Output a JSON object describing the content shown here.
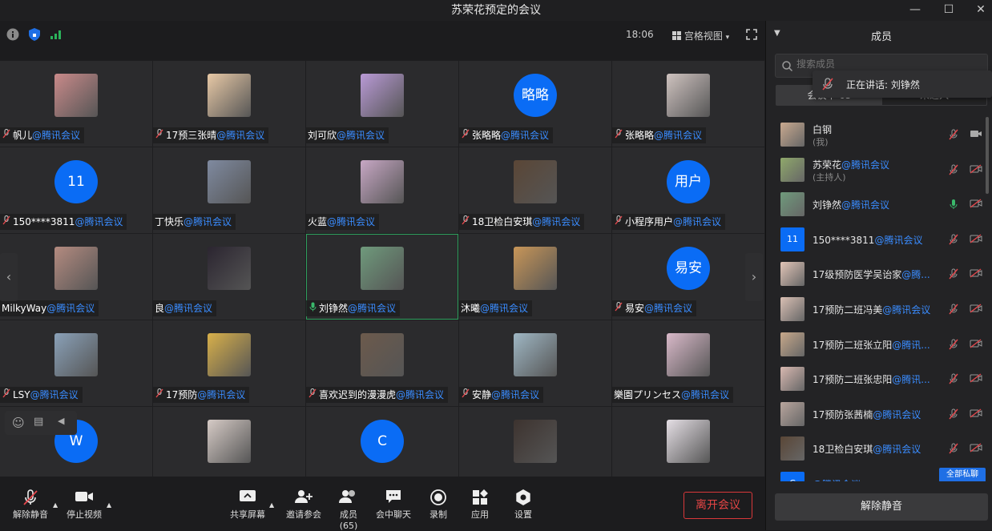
{
  "window": {
    "title": "苏荣花预定的会议",
    "minimize": "—",
    "maximize": "☐",
    "close": "✕"
  },
  "topbar": {
    "time": "18:06",
    "view_label": "宫格视图",
    "view_caret": "▾"
  },
  "grid": {
    "tiles": [
      {
        "name": "帆儿",
        "tag": "@腾讯会议",
        "mic": "muted",
        "avatar": {
          "type": "image",
          "color": "#c98a8a"
        }
      },
      {
        "name": "17预三张晴",
        "tag": "@腾讯会议",
        "mic": "muted",
        "avatar": {
          "type": "image",
          "color": "#e8c9a6"
        }
      },
      {
        "name": "刘可欣",
        "tag": "@腾讯会议",
        "mic": "none",
        "avatar": {
          "type": "image",
          "color": "#b99ad6"
        }
      },
      {
        "name": "张略略",
        "tag": "@腾讯会议",
        "mic": "muted",
        "avatar": {
          "type": "text",
          "text": "略略"
        }
      },
      {
        "name": "张略略",
        "tag": "@腾讯会议",
        "mic": "muted",
        "avatar": {
          "type": "image",
          "color": "#cfc3c0"
        }
      },
      {
        "name": "150****3811",
        "tag": "@腾讯会议",
        "mic": "muted",
        "avatar": {
          "type": "text",
          "text": "11"
        }
      },
      {
        "name": "丁快乐",
        "tag": "@腾讯会议",
        "mic": "none",
        "avatar": {
          "type": "image",
          "color": "#7f8aa0"
        }
      },
      {
        "name": "火蓝",
        "tag": "@腾讯会议",
        "mic": "none",
        "avatar": {
          "type": "image",
          "color": "#c7a7c4"
        }
      },
      {
        "name": "18卫检白安琪",
        "tag": "@腾讯会议",
        "mic": "muted",
        "avatar": {
          "type": "image",
          "color": "#5a4636"
        }
      },
      {
        "name": "小程序用户",
        "tag": "@腾讯会议",
        "mic": "muted",
        "avatar": {
          "type": "text",
          "text": "用户"
        }
      },
      {
        "name": "MilkyWay",
        "tag": "@腾讯会议",
        "mic": "none",
        "avatar": {
          "type": "image",
          "color": "#b48b80"
        }
      },
      {
        "name": "良",
        "tag": "@腾讯会议",
        "mic": "none",
        "avatar": {
          "type": "image",
          "color": "#2b2530"
        }
      },
      {
        "name": "刘铮然",
        "tag": "@腾讯会议",
        "mic": "on",
        "avatar": {
          "type": "image",
          "color": "#6f9a7c"
        },
        "active": true
      },
      {
        "name": "沐曦",
        "tag": "@腾讯会议",
        "mic": "none",
        "avatar": {
          "type": "image",
          "color": "#c89658"
        }
      },
      {
        "name": "易安",
        "tag": "@腾讯会议",
        "mic": "muted",
        "avatar": {
          "type": "text",
          "text": "易安"
        }
      },
      {
        "name": "LSY",
        "tag": "@腾讯会议",
        "mic": "muted",
        "avatar": {
          "type": "image",
          "color": "#8aa1b8"
        }
      },
      {
        "name": "17预防",
        "tag": "@腾讯会议",
        "mic": "muted",
        "avatar": {
          "type": "image",
          "color": "#d8b04a"
        }
      },
      {
        "name": "喜欢迟到的漫漫虎",
        "tag": "@腾讯会议",
        "mic": "muted",
        "avatar": {
          "type": "image",
          "color": "#6c5a4c"
        }
      },
      {
        "name": "安静",
        "tag": "@腾讯会议",
        "mic": "muted",
        "avatar": {
          "type": "image",
          "color": "#9fb7c4"
        }
      },
      {
        "name": "樂園プリンセス",
        "tag": "@腾讯会议",
        "mic": "none",
        "avatar": {
          "type": "image",
          "color": "#d9b9c9"
        }
      },
      {
        "name": "",
        "tag": "",
        "mic": "none",
        "avatar": {
          "type": "text",
          "text": "W"
        }
      },
      {
        "name": "",
        "tag": "",
        "mic": "none",
        "avatar": {
          "type": "image",
          "color": "#d6cbc6"
        }
      },
      {
        "name": "",
        "tag": "",
        "mic": "none",
        "avatar": {
          "type": "text",
          "text": "C"
        }
      },
      {
        "name": "",
        "tag": "",
        "mic": "none",
        "avatar": {
          "type": "image",
          "color": "#3d332f"
        }
      },
      {
        "name": "",
        "tag": "",
        "mic": "none",
        "avatar": {
          "type": "image",
          "color": "#e5dfe5"
        }
      }
    ],
    "prev_arrow": "‹",
    "next_arrow": "›"
  },
  "toolbar": {
    "unmute": "解除静音",
    "stop_video": "停止视频",
    "share": "共享屏幕",
    "invite": "邀请参会",
    "members": "成员(65)",
    "chat": "会中聊天",
    "record": "录制",
    "apps": "应用",
    "settings": "设置",
    "leave": "离开会议",
    "caret": "▲"
  },
  "sidebar": {
    "title": "成员",
    "search_placeholder": "搜索成员",
    "speaking_label": "正在讲话: 刘铮然",
    "tab_in_meeting": "会议中 65",
    "tab_not_joined": "未进入",
    "members": [
      {
        "name": "白钢",
        "tag": "",
        "sub": "(我)",
        "avatar_color": "#c9a98f",
        "mic": "muted",
        "cam": "on"
      },
      {
        "name": "苏荣花",
        "tag": "@腾讯会议",
        "sub": "(主持人)",
        "avatar_color": "#8fa86b",
        "mic": "muted",
        "cam": "off"
      },
      {
        "name": "刘铮然",
        "tag": "@腾讯会议",
        "sub": "",
        "avatar_color": "#6f9a7c",
        "mic": "on",
        "cam": "off"
      },
      {
        "name": "150****3811",
        "tag": "@腾讯会议",
        "sub": "",
        "avatar_color": "#0a6cf5",
        "avatar_text": "11",
        "mic": "muted",
        "cam": "off"
      },
      {
        "name": "17级预防医学吴诒家",
        "tag": "@腾...",
        "sub": "",
        "avatar_color": "#e2c5b7",
        "mic": "muted",
        "cam": "off"
      },
      {
        "name": "17预防二班冯美",
        "tag": "@腾讯会议",
        "sub": "",
        "avatar_color": "#d9bfb3",
        "mic": "muted",
        "cam": "off"
      },
      {
        "name": "17预防二班张立阳",
        "tag": "@腾讯...",
        "sub": "",
        "avatar_color": "#c7a88a",
        "mic": "muted",
        "cam": "off"
      },
      {
        "name": "17预防二班张忠阳",
        "tag": "@腾讯...",
        "sub": "",
        "avatar_color": "#d8b8b0",
        "mic": "muted",
        "cam": "off"
      },
      {
        "name": "17预防张茜楠",
        "tag": "@腾讯会议",
        "sub": "",
        "avatar_color": "#b8a59d",
        "mic": "muted",
        "cam": "off"
      },
      {
        "name": "18卫检白安琪",
        "tag": "@腾讯会议",
        "sub": "",
        "avatar_color": "#5a4636",
        "mic": "muted",
        "cam": "off"
      },
      {
        "name": "",
        "tag": "@腾讯会议",
        "sub": "",
        "avatar_color": "#0a6cf5",
        "avatar_text": "C",
        "mic": "",
        "cam": ""
      }
    ],
    "partial_button": "全部私聊",
    "unmute_all": "解除静音"
  }
}
